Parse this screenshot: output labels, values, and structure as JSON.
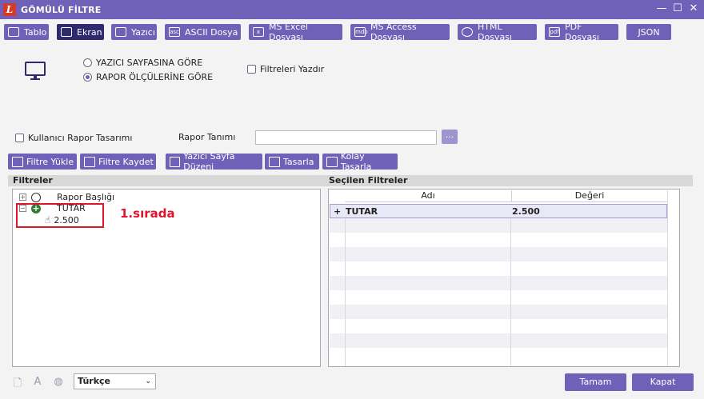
{
  "window": {
    "title": "GÖMÜLÜ FİLTRE",
    "logo_letter": "L"
  },
  "tabs": [
    {
      "label": "Tablo"
    },
    {
      "label": "Ekran"
    },
    {
      "label": "Yazıcı"
    },
    {
      "label": "ASCII Dosya"
    },
    {
      "label": "MS Excel Dosyası"
    },
    {
      "label": "MS Access Dosyası"
    },
    {
      "label": "HTML Dosyası"
    },
    {
      "label": "PDF Dosyası"
    },
    {
      "label": "JSON"
    }
  ],
  "active_tab": "Ekran",
  "output_options": {
    "radio1": "YAZICI SAYFASINA GÖRE",
    "radio2": "RAPOR ÖLÇÜLERİNE GÖRE",
    "selected": "RAPOR ÖLÇÜLERİNE GÖRE",
    "print_filters": "Filtreleri Yazdır"
  },
  "design": {
    "user_design": "Kullanıcı Rapor Tasarımı",
    "rapor_tanimi_label": "Rapor Tanımı",
    "rapor_tanimi_value": "",
    "dots": "..."
  },
  "actions": {
    "filtre_yukle": "Filtre Yükle",
    "filtre_kaydet": "Filtre Kaydet",
    "yazici_sayfa": "Yazıcı Sayfa Düzeni",
    "tasarla": "Tasarla",
    "kolay_tasarla": "Kolay Tasarla"
  },
  "filters_panel": {
    "title": "Filtreler",
    "items": [
      {
        "label": "Rapor Başlığı"
      },
      {
        "label": "TUTAR",
        "value": "2.500"
      }
    ]
  },
  "annotation": "1.sırada",
  "selected_filters": {
    "title": "Seçilen Filtreler",
    "columns": [
      "Adı",
      "Değeri"
    ],
    "rows": [
      {
        "name": "TUTAR",
        "value": "2.500",
        "prefix": "+"
      }
    ]
  },
  "footer": {
    "language": "Türkçe",
    "ok": "Tamam",
    "close": "Kapat"
  }
}
